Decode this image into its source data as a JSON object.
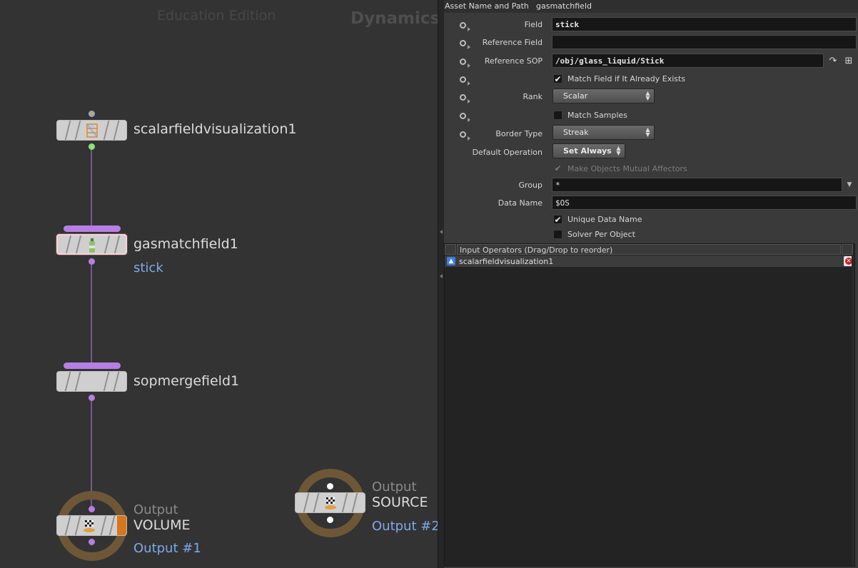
{
  "network": {
    "watermark": "Education Edition",
    "context": "Dynamics",
    "nodes": [
      {
        "name": "scalarfieldvisualization1"
      },
      {
        "name": "gasmatchfield1",
        "comment": "stick"
      },
      {
        "name": "sopmergefield1"
      },
      {
        "label": "Output",
        "name": "VOLUME",
        "comment": "Output #1"
      },
      {
        "label": "Output",
        "name": "SOURCE",
        "comment": "Output #2"
      }
    ]
  },
  "params": {
    "header": {
      "label": "Asset Name and Path",
      "value": "gasmatchfield"
    },
    "field": {
      "label": "Field",
      "value": "stick"
    },
    "reference_field": {
      "label": "Reference Field",
      "value": ""
    },
    "reference_sop": {
      "label": "Reference SOP",
      "value": "/obj/glass_liquid/Stick"
    },
    "match_field": {
      "label": "Match Field if It Already Exists",
      "checked": true
    },
    "rank": {
      "label": "Rank",
      "value": "Scalar"
    },
    "match_samples": {
      "label": "Match Samples",
      "checked": false
    },
    "border_type": {
      "label": "Border Type",
      "value": "Streak"
    },
    "default_operation": {
      "label": "Default Operation",
      "value": "Set Always"
    },
    "mutual_affectors": {
      "label": "Make Objects Mutual Affectors",
      "checked": true,
      "disabled": true
    },
    "group": {
      "label": "Group",
      "value": "*"
    },
    "data_name": {
      "label": "Data Name",
      "value": "$OS"
    },
    "unique_data_name": {
      "label": "Unique Data Name",
      "checked": true
    },
    "solver_per_object": {
      "label": "Solver Per Object",
      "checked": false
    },
    "input_operators": {
      "header": "Input Operators (Drag/Drop to reorder)",
      "rows": [
        {
          "name": "scalarfieldvisualization1"
        }
      ]
    }
  },
  "colors": {
    "node_body": "#cfcfcf",
    "flag_purple": "#b67fe4",
    "port_green": "#8ee07c",
    "output_ring": "#6e5736",
    "output_flag": "#d9761c",
    "comment_blue": "#7ea9e8"
  },
  "icons": {
    "scalarfieldvisualization1": "scaffold-icon",
    "gasmatchfield1": "bottle-icon",
    "output": "checkered-flag-icon",
    "reference_sop_jump": "jump-arrow-icon",
    "reference_sop_select": "select-node-icon",
    "input_operator": "up-arrow-icon",
    "delete": "delete-icon"
  }
}
